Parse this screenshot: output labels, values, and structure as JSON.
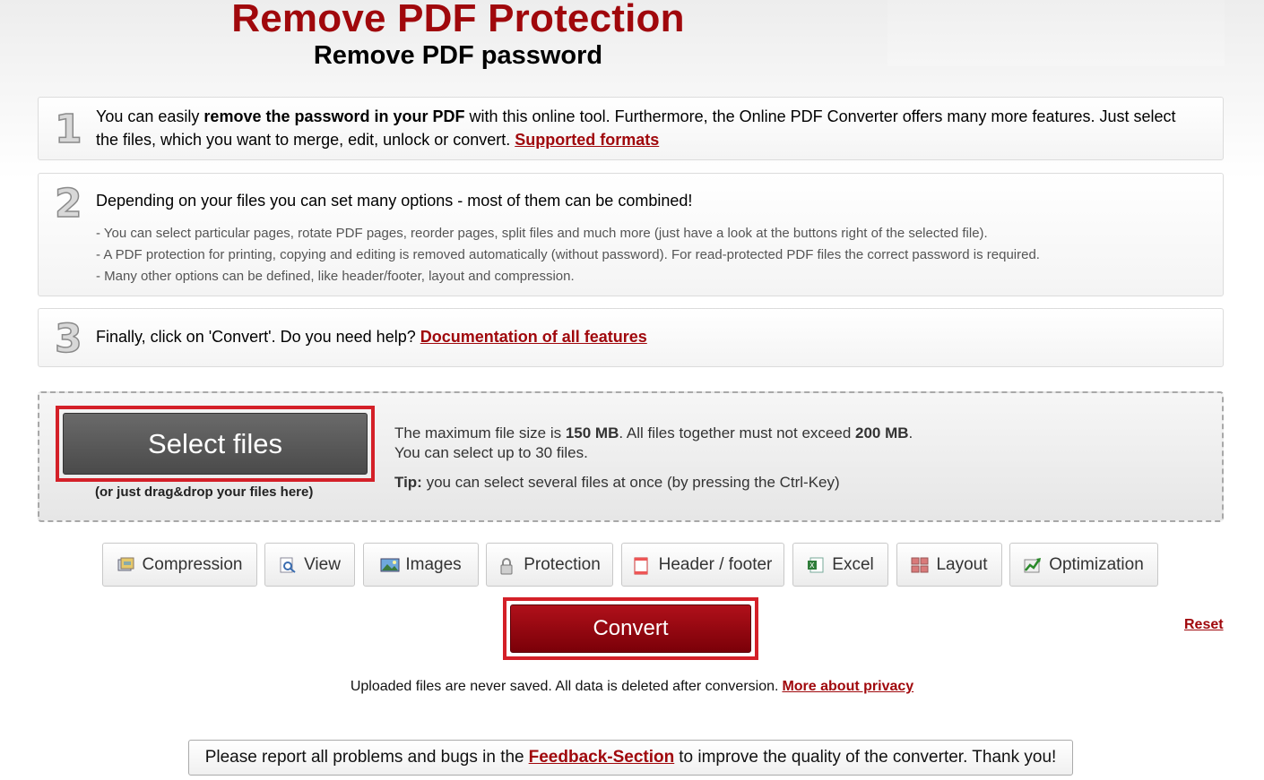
{
  "header": {
    "title": "Remove PDF Protection",
    "subtitle": "Remove PDF password"
  },
  "steps": [
    {
      "number": "1",
      "text_before": "You can easily ",
      "text_bold": "remove the password in your PDF",
      "text_after": " with this online tool. Furthermore, the Online PDF Converter offers many more features. Just select the files, which you want to merge, edit, unlock or convert. ",
      "link": "Supported formats"
    },
    {
      "number": "2",
      "text": "Depending on your files you can set many options - most of them can be combined!",
      "bullets": [
        "- You can select particular pages, rotate PDF pages, reorder pages, split files and much more (just have a look at the buttons right of the selected file).",
        "- A PDF protection for printing, copying and editing is removed automatically (without password). For read-protected PDF files the correct password is required.",
        "- Many other options can be defined, like header/footer, layout and compression."
      ]
    },
    {
      "number": "3",
      "text": "Finally, click on 'Convert'. Do you need help? ",
      "link": "Documentation of all features"
    }
  ],
  "upload": {
    "select_label": "Select files",
    "drag_note": "(or just drag&drop your files here)",
    "limit_prefix": "The maximum file size is ",
    "limit_size": "150 MB",
    "limit_middle": ". All files together must not exceed ",
    "limit_total": "200 MB",
    "limit_suffix": ".",
    "limit_count": "You can select up to 30 files.",
    "tip_label": "Tip:",
    "tip_text": " you can select several files at once (by pressing the Ctrl-Key)"
  },
  "options": [
    {
      "label": "Compression",
      "icon": "compression-icon"
    },
    {
      "label": "View",
      "icon": "view-icon"
    },
    {
      "label": "Images",
      "icon": "images-icon"
    },
    {
      "label": "Protection",
      "icon": "protection-icon"
    },
    {
      "label": "Header / footer",
      "icon": "header-footer-icon"
    },
    {
      "label": "Excel",
      "icon": "excel-icon"
    },
    {
      "label": "Layout",
      "icon": "layout-icon"
    },
    {
      "label": "Optimization",
      "icon": "optimization-icon"
    }
  ],
  "actions": {
    "convert_label": "Convert",
    "reset_label": "Reset"
  },
  "privacy": {
    "text": "Uploaded files are never saved. All data is deleted after conversion.",
    "link": "More about privacy"
  },
  "feedback": {
    "before": "Please report all problems and bugs in the",
    "link": "Feedback-Section",
    "after": "to improve the quality of the converter. Thank you!"
  },
  "colors": {
    "brand_red": "#a0080c",
    "highlight_outline": "#d42028"
  }
}
